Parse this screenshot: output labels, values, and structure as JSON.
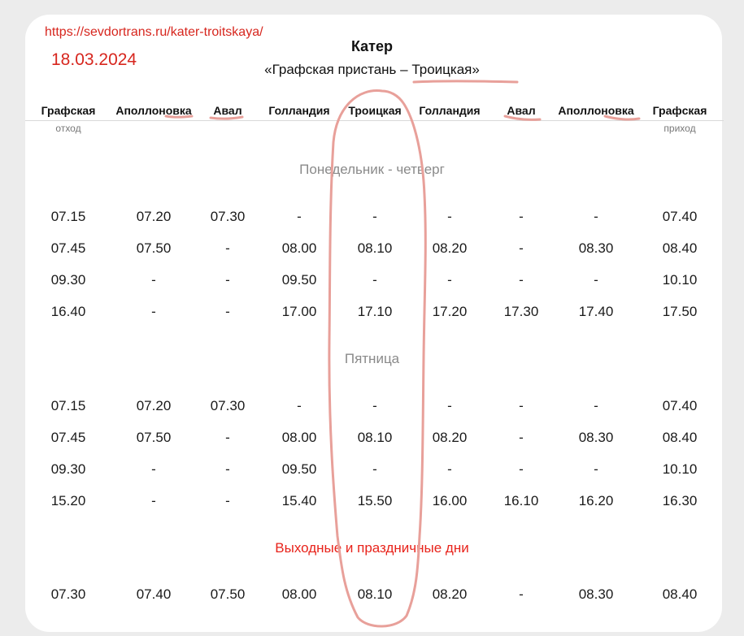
{
  "source": {
    "url": "https://sevdortrans.ru/kater-troitskaya/",
    "date": "18.03.2024"
  },
  "title": "Катер",
  "subtitle": "«Графская пристань – Троицкая»",
  "columns": [
    "Графская",
    "Аполлоновка",
    "Авал",
    "Голландия",
    "Троицкая",
    "Голландия",
    "Авал",
    "Аполлоновка",
    "Графская"
  ],
  "column_subs": {
    "first": "отход",
    "last": "приход"
  },
  "sections": [
    {
      "label": "Понедельник - четверг",
      "highlight": false,
      "rows": [
        [
          "07.15",
          "07.20",
          "07.30",
          "-",
          "-",
          "-",
          "-",
          "-",
          "07.40"
        ],
        [
          "07.45",
          "07.50",
          "-",
          "08.00",
          "08.10",
          "08.20",
          "-",
          "08.30",
          "08.40"
        ],
        [
          "09.30",
          "-",
          "-",
          "09.50",
          "-",
          "-",
          "-",
          "-",
          "10.10"
        ],
        [
          "16.40",
          "-",
          "-",
          "17.00",
          "17.10",
          "17.20",
          "17.30",
          "17.40",
          "17.50"
        ]
      ]
    },
    {
      "label": "Пятница",
      "highlight": false,
      "rows": [
        [
          "07.15",
          "07.20",
          "07.30",
          "-",
          "-",
          "-",
          "-",
          "-",
          "07.40"
        ],
        [
          "07.45",
          "07.50",
          "-",
          "08.00",
          "08.10",
          "08.20",
          "-",
          "08.30",
          "08.40"
        ],
        [
          "09.30",
          "-",
          "-",
          "09.50",
          "-",
          "-",
          "-",
          "-",
          "10.10"
        ],
        [
          "15.20",
          "-",
          "-",
          "15.40",
          "15.50",
          "16.00",
          "16.10",
          "16.20",
          "16.30"
        ]
      ]
    },
    {
      "label": "Выходные и праздничные дни",
      "highlight": true,
      "rows": [
        [
          "07.30",
          "07.40",
          "07.50",
          "08.00",
          "08.10",
          "08.20",
          "-",
          "08.30",
          "08.40"
        ]
      ]
    }
  ],
  "colors": {
    "annotation": "#e8a09a",
    "accent_red": "#e8231b",
    "url_red": "#d7261e"
  }
}
